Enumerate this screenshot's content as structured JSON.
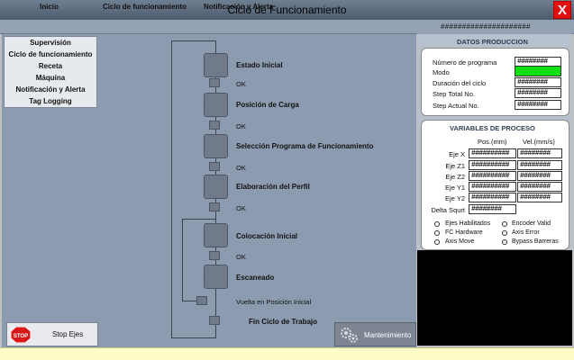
{
  "window": {
    "title": "Ciclo de Funcionamiento",
    "close_label": "X"
  },
  "menu": {
    "inicio": "Inicio",
    "ciclo": "Ciclo de funcionamiento",
    "notificacion": "Notificación y Alerta",
    "status_hash": "#####################"
  },
  "nav": [
    "Supervisión",
    "Ciclo de funcionamiento",
    "Receta",
    "Máquina",
    "Notificación y Alerta",
    "Tag Logging"
  ],
  "steps": [
    {
      "label": "Estado Inicial",
      "ok": "OK"
    },
    {
      "label": "Posición de Carga",
      "ok": "OK"
    },
    {
      "label": "Selección Programa de Funcionamiento",
      "ok": "OK"
    },
    {
      "label": "Elaboración del Perfil",
      "ok": "OK"
    },
    {
      "label": "Colocación Inicial",
      "ok": "OK"
    },
    {
      "label": "Escaneado"
    }
  ],
  "return_label": "Vuelta en Posición Inicial",
  "end_label": "Fin Ciclo de Trabajo",
  "buttons": {
    "stop": "Stop Ejes",
    "stop_icon_text": "STOP",
    "mantenimiento": "Mantenimiento"
  },
  "produccion": {
    "title": "DATOS PRODUCCION",
    "rows": [
      {
        "label": "Número de programa",
        "value": "########"
      },
      {
        "label": "Modo",
        "value": ""
      },
      {
        "label": "Duración del ciclo",
        "value": "########"
      },
      {
        "label": "Step Total No.",
        "value": "########"
      },
      {
        "label": "Step Actual No.",
        "value": "########"
      }
    ],
    "mode_color": "#10e010"
  },
  "proceso": {
    "title": "VARIABLES DE PROCESO",
    "col_pos": "Pos.(mm)",
    "col_vel": "Vel.(mm/s)",
    "axes": [
      {
        "label": "Eje X",
        "pos": "##########",
        "vel": "########"
      },
      {
        "label": "Eje Z1",
        "pos": "##########",
        "vel": "########"
      },
      {
        "label": "Eje Z2",
        "pos": "##########",
        "vel": "########"
      },
      {
        "label": "Eje Y1",
        "pos": "##########",
        "vel": "########"
      },
      {
        "label": "Eje Y2",
        "pos": "##########",
        "vel": "########"
      }
    ],
    "delta_label": "Delta Squrt",
    "delta_value": "########",
    "status_left": [
      "Ejes Habilitados",
      "FC Hardware",
      "Axis Move"
    ],
    "status_right": [
      "Encoder Valid",
      "Axis Error",
      "Bypass Barreras"
    ]
  }
}
